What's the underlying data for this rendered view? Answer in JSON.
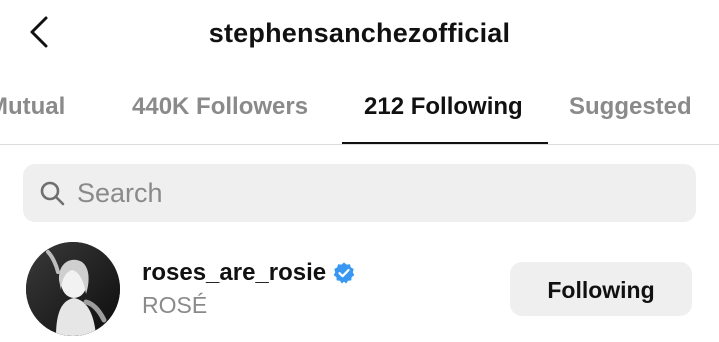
{
  "header": {
    "title": "stephensanchezofficial",
    "back_icon": "chevron-left-icon"
  },
  "tabs": [
    {
      "label": "Mutual",
      "active": false
    },
    {
      "label": "440K Followers",
      "active": false
    },
    {
      "label": "212 Following",
      "active": true
    },
    {
      "label": "Suggested",
      "active": false
    }
  ],
  "search": {
    "placeholder": "Search",
    "value": "",
    "icon": "search-icon"
  },
  "list": [
    {
      "username": "roses_are_rosie",
      "full_name": "ROSÉ",
      "verified": true,
      "button_label": "Following"
    }
  ],
  "colors": {
    "verified_badge": "#3897f0",
    "secondary_text": "#8a8a8a",
    "button_bg": "#efefef"
  }
}
